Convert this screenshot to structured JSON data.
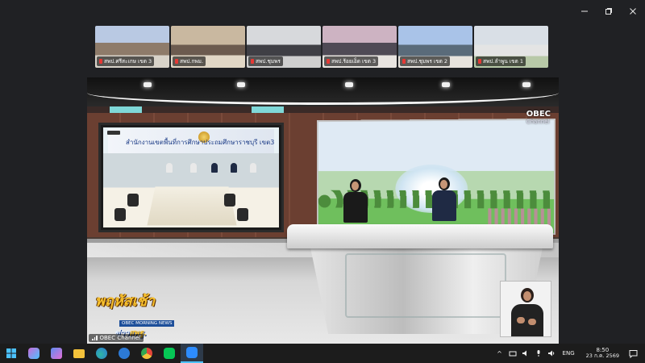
{
  "window": {
    "controls": [
      "minimize",
      "restore",
      "close"
    ]
  },
  "participants": [
    {
      "label": "สพป.ศรีสะเกษ เขต 3",
      "bg": "#b9c9e3"
    },
    {
      "label": "สพป.กพม.",
      "bg": "#c9b8a0"
    },
    {
      "label": "สพป.ชุมพร",
      "bg": "#d7d9dc"
    },
    {
      "label": "สพป.ร้อยเอ็ด เขต 3",
      "bg": "#cdb3c2"
    },
    {
      "label": "สพป.ชุมพร เขต 2",
      "bg": "#a9c3e8"
    },
    {
      "label": "สพป.ลำพูน เขต 1",
      "bg": "#d9dfe6"
    }
  ],
  "broadcast": {
    "left_screen_banner": "สำนักงานเขตพื้นที่การศึกษาประถมศึกษาราชบุรี เขต3",
    "logo": "OBEC",
    "logo_sub": "Channel",
    "program_title": "พฤหัสเช้า",
    "program_sub": "OBEC MORNING NEWS",
    "program_news_prefix": "ข่าว",
    "program_news_suffix": "สพฐ.",
    "channel_tag": "OBEC Channel"
  },
  "taskbar": {
    "apps": [
      {
        "name": "start-button",
        "color": "#4cc2ff"
      },
      {
        "name": "copilot-app",
        "color": "#c86bd9"
      },
      {
        "name": "mini-app",
        "color": "#5f8cf0"
      },
      {
        "name": "file-explorer-app",
        "color": "#f4c23b"
      },
      {
        "name": "edge-app",
        "color": "#2fb7a3"
      },
      {
        "name": "ie-app",
        "color": "#2c7ad6"
      },
      {
        "name": "chrome-app",
        "color": "#e5463a"
      },
      {
        "name": "line-app",
        "color": "#06c755"
      },
      {
        "name": "zoom-app",
        "color": "#2d8cff"
      }
    ],
    "lang": "ENG",
    "time": "8:50",
    "date": "23 ก.ค. 2569"
  }
}
